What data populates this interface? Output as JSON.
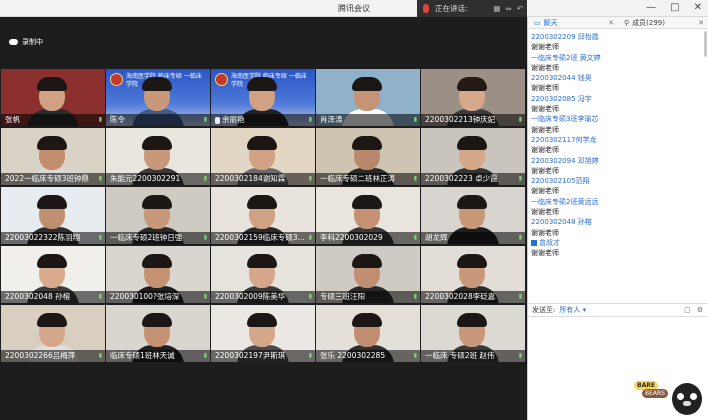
{
  "window": {
    "title": "腾讯会议",
    "min": "—",
    "max": "□",
    "close": "✕"
  },
  "speaking": {
    "label": "正在讲话:"
  },
  "recording": {
    "label": "录制中"
  },
  "tiles": [
    {
      "name": "张帆",
      "banner": false,
      "face": "#d0a283",
      "hair": "#1c1714",
      "shirt": "#2b2b2b",
      "bg": "#8b2f2f"
    },
    {
      "name": "陈令",
      "banner": true,
      "face": "#c7987a",
      "hair": "#1c1714",
      "shirt": "#3e5a87",
      "bg": "#4d79d8"
    },
    {
      "name": "余丽艳",
      "banner": true,
      "mic": true,
      "face": "#d0a283",
      "hair": "#1c1714",
      "shirt": "#222222",
      "bg": "#4d79d8"
    },
    {
      "name": "肖泽涛",
      "face": "#c69376",
      "hair": "#1c1714",
      "shirt": "#fbfbfb",
      "bg": "#8fb1c9"
    },
    {
      "name": "2200302213钟庆妃",
      "face": "#d6a98d",
      "hair": "#231a14",
      "shirt": "#3d3d3d",
      "bg": "#9c8f86"
    },
    {
      "name": "2022一临床专硕3班钟鼎",
      "face": "#c38e6f",
      "hair": "#1c1714",
      "shirt": "#d8d8d8",
      "bg": "#d9d2c6"
    },
    {
      "name": "朱能元2200302291",
      "face": "#c7987a",
      "hair": "#1c1714",
      "shirt": "#3a3a3a",
      "bg": "#e9e6e0"
    },
    {
      "name": "2200302184谢知霖",
      "face": "#d0a283",
      "hair": "#1c1714",
      "shirt": "#6a6a6a",
      "bg": "#e2d6c4"
    },
    {
      "name": "一临床专硕二班林正涛",
      "face": "#b9876b",
      "hair": "#1c1714",
      "shirt": "#2a2a2a",
      "bg": "#cfc4b2"
    },
    {
      "name": "2200302223 卓少霞",
      "face": "#d4a68a",
      "hair": "#1c1714",
      "shirt": "#353535",
      "bg": "#c9c4bd"
    },
    {
      "name": "22003022322陈羽翔",
      "face": "#c08f71",
      "hair": "#1c1714",
      "shirt": "#2d2d2d",
      "bg": "#e7ecf0"
    },
    {
      "name": "一临床专硕2班钟日强",
      "face": "#c7987a",
      "hair": "#1c1714",
      "shirt": "#2a2a2a",
      "bg": "#cfcac2"
    },
    {
      "name": "2200302159临床专硕3...",
      "face": "#d0a283",
      "hair": "#1c1714",
      "shirt": "#2a2a2a",
      "bg": "#e8e3dc"
    },
    {
      "name": "李科2200302029",
      "face": "#c49273",
      "hair": "#1c1714",
      "shirt": "#3a3a3a",
      "bg": "#e9e4dc"
    },
    {
      "name": "胡龙辉",
      "face": "#c79878",
      "hair": "#1c1714",
      "shirt": "#1f1f1f",
      "bg": "#d8d4cf"
    },
    {
      "name": "2200302048 孙榕",
      "face": "#d8ab8f",
      "hair": "#1c1714",
      "shirt": "#3d3d3d",
      "bg": "#f1efec"
    },
    {
      "name": "220030100?张培深",
      "face": "#c49273",
      "hair": "#1c1714",
      "shirt": "#1f1f1f",
      "bg": "#d9d6d0"
    },
    {
      "name": "2200302009陈美华",
      "face": "#d4a68a",
      "hair": "#1c1714",
      "shirt": "#3a3a3a",
      "bg": "#e6e3dd"
    },
    {
      "name": "专硕三班汪阳",
      "face": "#c08f71",
      "hair": "#1c1714",
      "shirt": "#2a2a2a",
      "bg": "#cfcac4"
    },
    {
      "name": "2200302028李砭嘉",
      "face": "#c7987a",
      "hair": "#1c1714",
      "shirt": "#2b2b2b",
      "bg": "#e2ddd6"
    },
    {
      "name": "2200302266吕梅萍",
      "face": "#d4a68a",
      "hair": "#1c1714",
      "shirt": "#e0e0e0",
      "bg": "#d9cfc0"
    },
    {
      "name": "临床专硕1班林天诚",
      "face": "#c49273",
      "hair": "#1c1714",
      "shirt": "#1f1f1f",
      "bg": "#d9d6d0"
    },
    {
      "name": "2200302197尹斯琪",
      "face": "#d4a68a",
      "hair": "#1c1714",
      "shirt": "#4a4a4a",
      "bg": "#ebe7e2"
    },
    {
      "name": "张乐 2200302285",
      "face": "#c08f71",
      "hair": "#1c1714",
      "shirt": "#2e2e2e",
      "bg": "#e4dfd7"
    },
    {
      "name": "一临床 专硕2班 赵伟",
      "face": "#c7987a",
      "hair": "#1c1714",
      "shirt": "#3a3a3a",
      "bg": "#dcd8d2"
    }
  ],
  "banner_text": "海南医学院 临床专硕 一临床学院",
  "chat": {
    "tab_chat": "聊天",
    "tab_members": "成员(299)",
    "messages": [
      {
        "t": "name",
        "v": "2200302209 邱怡霞"
      },
      {
        "t": "text",
        "v": "谢谢老师"
      },
      {
        "t": "name",
        "v": "一临床专硕2班 黄文婷"
      },
      {
        "t": "text",
        "v": "谢谢老师"
      },
      {
        "t": "name",
        "v": "2200302044  钱昊"
      },
      {
        "t": "text",
        "v": "谢谢老师"
      },
      {
        "t": "name",
        "v": "2200302085 冯宇"
      },
      {
        "t": "text",
        "v": "谢谢老师"
      },
      {
        "t": "name",
        "v": "一临床专硕3班李瑜芯"
      },
      {
        "t": "text",
        "v": "谢谢老师"
      },
      {
        "t": "name",
        "v": "2200302117何学龙"
      },
      {
        "t": "text",
        "v": "谢谢老师"
      },
      {
        "t": "name",
        "v": "2200302094 邓旭婷"
      },
      {
        "t": "text",
        "v": "谢谢老师"
      },
      {
        "t": "name",
        "v": "2200302105范翔"
      },
      {
        "t": "text",
        "v": "谢谢老师"
      },
      {
        "t": "name",
        "v": "一临床专硕2班黄远远"
      },
      {
        "t": "text",
        "v": "谢谢老师"
      },
      {
        "t": "name",
        "v": "2200302048 孙榕"
      },
      {
        "t": "text",
        "v": "谢谢老师"
      },
      {
        "t": "name",
        "v": "曾叔才",
        "tag": true
      },
      {
        "t": "text",
        "v": "谢谢老师"
      }
    ],
    "send_label": "发送至:",
    "send_to": "所有人",
    "mascot_badge1": "BARE",
    "mascot_badge2": "BEARS"
  }
}
